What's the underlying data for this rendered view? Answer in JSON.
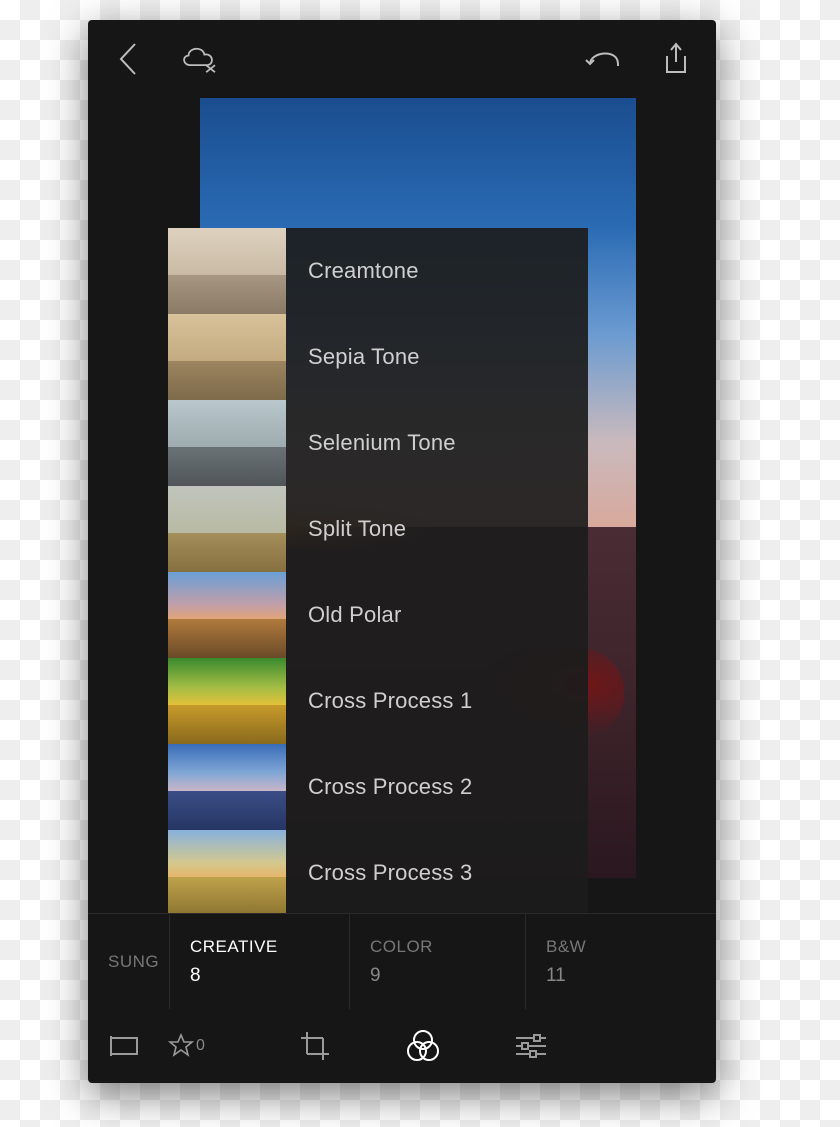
{
  "topbar": {
    "back": "Back",
    "cloud_cancel": "Cloud Sync Off",
    "undo": "Undo",
    "share": "Share"
  },
  "presets": [
    {
      "label": "Creamtone"
    },
    {
      "label": "Sepia Tone"
    },
    {
      "label": "Selenium Tone"
    },
    {
      "label": "Split Tone"
    },
    {
      "label": "Old Polar"
    },
    {
      "label": "Cross Process 1"
    },
    {
      "label": "Cross Process 2"
    },
    {
      "label": "Cross Process 3"
    }
  ],
  "categories": [
    {
      "label": "SUNG",
      "count": "",
      "active": false
    },
    {
      "label": "CREATIVE",
      "count": "8",
      "active": true
    },
    {
      "label": "COLOR",
      "count": "9",
      "active": false
    },
    {
      "label": "B&W",
      "count": "11",
      "active": false
    }
  ],
  "bottom": {
    "star_count": "0"
  }
}
